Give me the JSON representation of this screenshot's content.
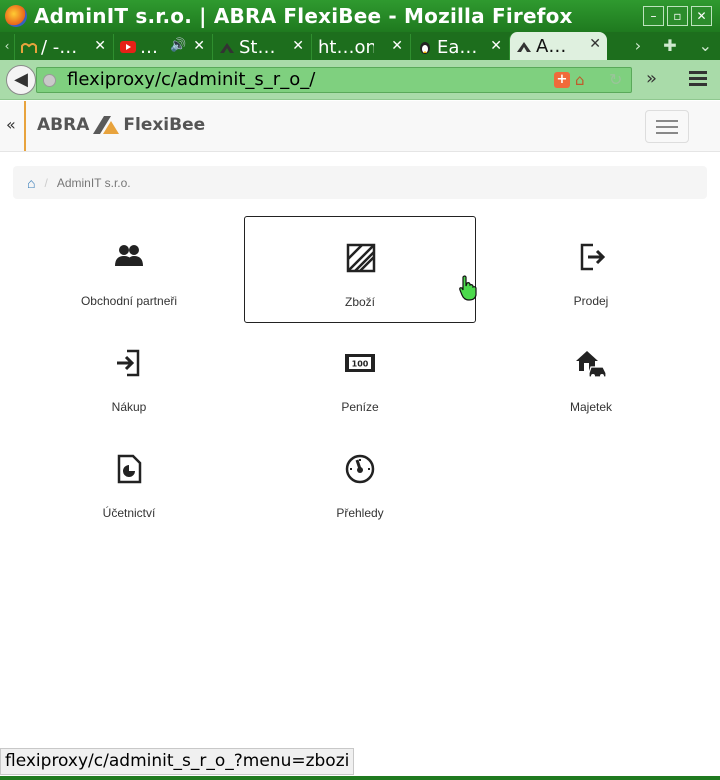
{
  "window": {
    "title": "AdminIT s.r.o. | ABRA FlexiBee - Mozilla Firefox",
    "buttons": [
      "–",
      "▫",
      "✕"
    ]
  },
  "tabs": [
    {
      "label": "/ -…",
      "icon": "moodle-icon",
      "active": false
    },
    {
      "label": "…",
      "icon": "youtube-icon",
      "audio": true,
      "active": false
    },
    {
      "label": "St…",
      "icon": "abra-icon",
      "active": false
    },
    {
      "label": "ht…on",
      "icon": "",
      "active": false
    },
    {
      "label": "Ea…",
      "icon": "penguin-icon",
      "active": false
    },
    {
      "label": "A…",
      "icon": "abra-icon",
      "active": true
    }
  ],
  "navbar": {
    "url": "flexiproxy/c/adminit_s_r_o_/"
  },
  "app": {
    "brand_left": "ABRA",
    "brand_right": "FlexiBee"
  },
  "breadcrumb": {
    "company": "AdminIT s.r.o."
  },
  "tiles": [
    {
      "label": "Obchodní partneři",
      "icon": "partners-icon"
    },
    {
      "label": "Zboží",
      "icon": "goods-icon",
      "hovered": true
    },
    {
      "label": "Prodej",
      "icon": "sale-icon"
    },
    {
      "label": "Nákup",
      "icon": "purchase-icon"
    },
    {
      "label": "Peníze",
      "icon": "money-icon"
    },
    {
      "label": "Majetek",
      "icon": "property-icon"
    },
    {
      "label": "Účetnictví",
      "icon": "accounting-icon"
    },
    {
      "label": "Přehledy",
      "icon": "dashboard-icon"
    }
  ],
  "status": {
    "link": "flexiproxy/c/adminit_s_r_o_?menu=zbozi"
  }
}
